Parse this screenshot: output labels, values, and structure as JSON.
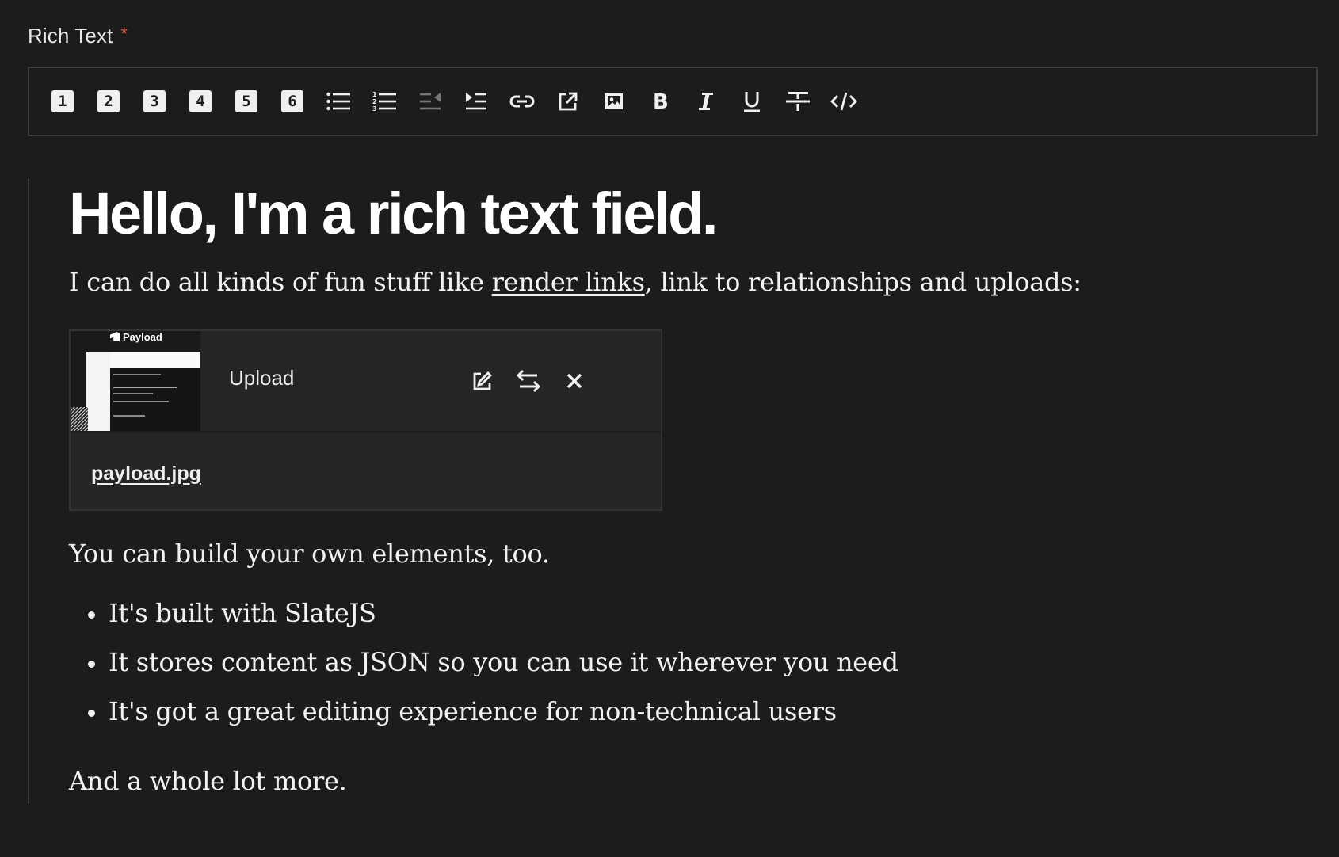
{
  "field": {
    "label": "Rich Text",
    "required_mark": "*"
  },
  "toolbar": {
    "headings": [
      "1",
      "2",
      "3",
      "4",
      "5",
      "6"
    ],
    "icons": [
      "unordered-list-icon",
      "ordered-list-icon",
      "outdent-icon",
      "indent-icon",
      "link-icon",
      "relationship-icon",
      "upload-icon",
      "bold-icon",
      "italic-icon",
      "underline-icon",
      "strikethrough-icon",
      "code-icon"
    ]
  },
  "content": {
    "heading": "Hello, I'm a rich text field.",
    "intro_before": "I can do all kinds of fun stuff like ",
    "intro_link": "render links",
    "intro_after": ", link to relationships and uploads:",
    "upload": {
      "label": "Upload",
      "filename": "payload.jpg",
      "thumbnail_brand": "Payload"
    },
    "custom_elements": "You can build your own elements, too.",
    "bullets": [
      "It's built with SlateJS",
      "It stores content as JSON so you can use it wherever you need",
      "It's got a great editing experience for non-technical users"
    ],
    "closing": "And a whole lot more."
  },
  "colors": {
    "background": "#1c1c1c",
    "border": "#3e3e3e",
    "required": "#e05a4f",
    "card": "#252525"
  }
}
